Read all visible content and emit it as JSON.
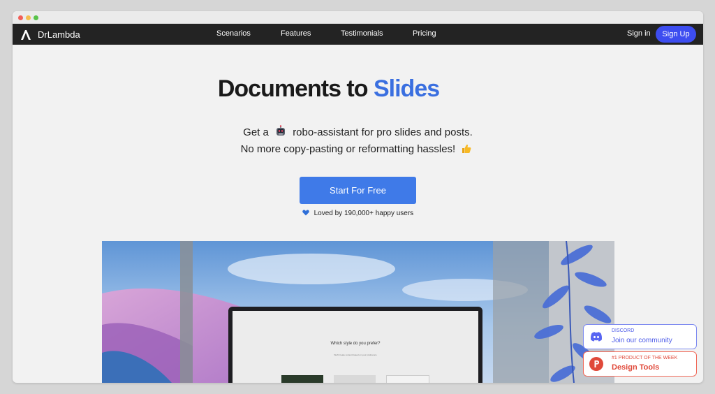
{
  "brand": {
    "name": "DrLambda"
  },
  "nav": {
    "links": [
      "Scenarios",
      "Features",
      "Testimonials",
      "Pricing"
    ],
    "signin": "Sign in",
    "signup": "Sign Up"
  },
  "hero": {
    "title_main": "Documents to",
    "title_accent": "Slides",
    "line1_before": "Get a",
    "line1_after": "robo-assistant for pro slides and posts.",
    "line2": "No more copy-pasting or reformatting hassles!",
    "cta": "Start For Free",
    "loved": "Loved by 190,000+ happy users"
  },
  "preview": {
    "question": "Which style do you prefer?",
    "subtext": "We'll create content based on your preference"
  },
  "widgets": {
    "discord": {
      "small": "DISCORD",
      "big": "Join our community"
    },
    "product_hunt": {
      "small": "#1 PRODUCT OF THE WEEK",
      "big": "Design Tools"
    }
  },
  "colors": {
    "nav_bg": "#232323",
    "accent": "#3a6fe0",
    "signup_bg": "#3d4df0",
    "cta_bg": "#3f7ae8",
    "discord": "#5865f2",
    "product_hunt": "#e0493a"
  },
  "icons": [
    "lambda-logo-icon",
    "robot-emoji-icon",
    "thumbs-up-emoji-icon",
    "blue-heart-icon",
    "discord-icon",
    "product-hunt-icon"
  ]
}
